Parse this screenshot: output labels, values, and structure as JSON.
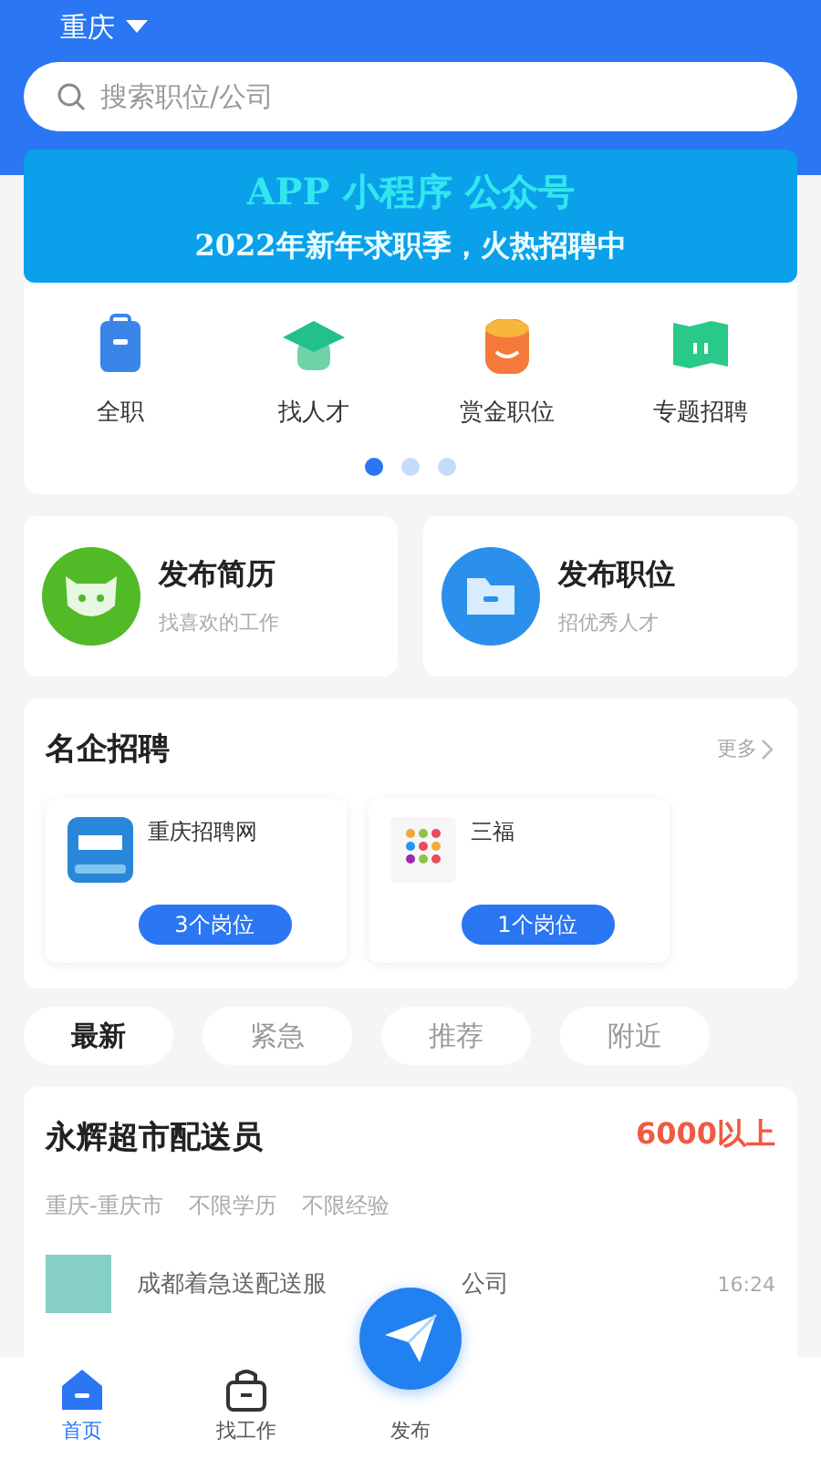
{
  "header": {
    "city": "重庆",
    "search": {
      "placeholder": "搜索职位/公司"
    }
  },
  "banner": {
    "line_1": "APP 小程序 公众号",
    "line_2": "2022年新年求职季，火热招聘中"
  },
  "quick_links": [
    {
      "label": "全职",
      "kind": "bag"
    },
    {
      "label": "找人才",
      "kind": "cap"
    },
    {
      "label": "赏金职位",
      "kind": "coin"
    },
    {
      "label": "专题招聘",
      "kind": "map"
    }
  ],
  "pager": [
    {
      "selected": true
    },
    {
      "selected": false
    },
    {
      "selected": false
    }
  ],
  "publish_cards": [
    {
      "title": "发布简历",
      "subtitle": "找喜欢的工作",
      "kind": "resume"
    },
    {
      "title": "发布职位",
      "subtitle": "招优秀人才",
      "kind": "job"
    }
  ],
  "famous_companies": {
    "title": "名企招聘",
    "more": "更多",
    "companies": [
      {
        "name": "重庆招聘网",
        "positions": "3个岗位",
        "kind": "blue"
      },
      {
        "name": "三福",
        "positions": "1个岗位",
        "kind": "grid"
      }
    ]
  },
  "filter_tabs": [
    {
      "label": "最新",
      "selected": true
    },
    {
      "label": "紧急",
      "selected": false
    },
    {
      "label": "推荐",
      "selected": false
    },
    {
      "label": "附近",
      "selected": false
    }
  ],
  "job": {
    "title": "永辉超市配送员",
    "salary": "6000以上",
    "tags": [
      "重庆-重庆市",
      "不限学历",
      "不限经验"
    ],
    "company_start": "成都着急送配送服",
    "company_end": "公司",
    "time": "16:24"
  },
  "bottom_nav": [
    {
      "label": "首页",
      "selected": true,
      "kind": "home"
    },
    {
      "label": "找工作",
      "selected": false,
      "kind": "bag"
    },
    {
      "label": "发布",
      "selected": false,
      "kind": "send"
    }
  ]
}
